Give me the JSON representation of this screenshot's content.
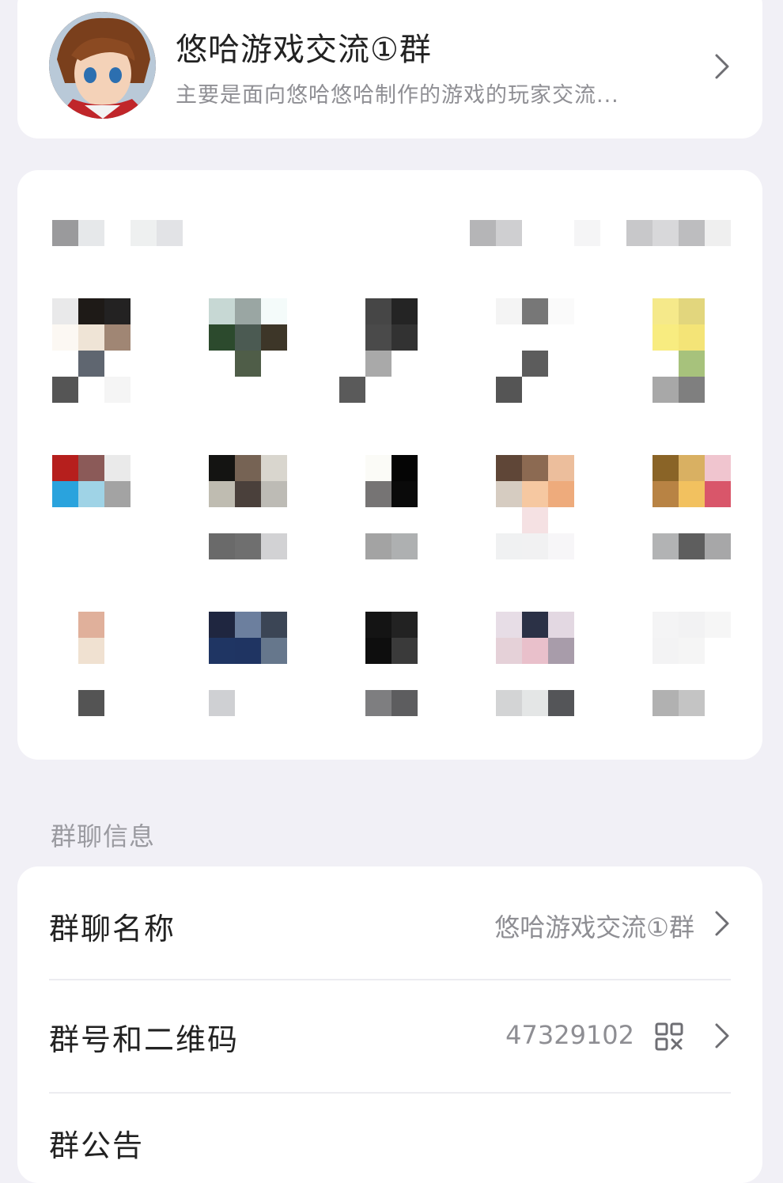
{
  "group": {
    "name": "悠哈游戏交流①群",
    "description": "主要是面向悠哈悠哈制作的游戏的玩家交流..."
  },
  "info_section": {
    "title": "群聊信息",
    "rows": [
      {
        "label": "群聊名称",
        "value": "悠哈游戏交流①群"
      },
      {
        "label": "群号和二维码",
        "value": "47329102"
      },
      {
        "label": "群公告",
        "value": ""
      }
    ]
  },
  "colors": {
    "background": "#f1f0f6",
    "card": "#ffffff",
    "secondary_text": "#8e8e93"
  },
  "icons": [
    "chevron-right-icon",
    "qr-code-icon"
  ]
}
